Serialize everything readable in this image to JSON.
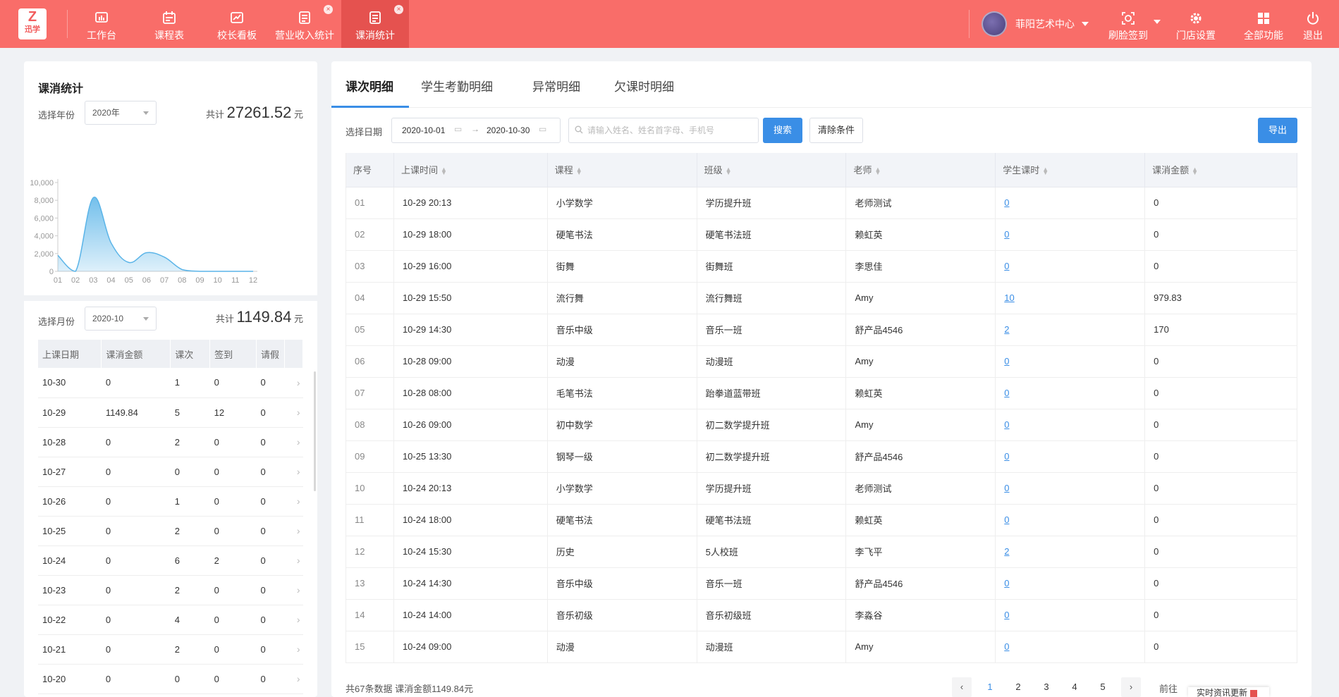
{
  "logo": {
    "mark": "Z",
    "text": "迅学"
  },
  "nav": [
    {
      "label": "工作台",
      "icon": "bar-chart-icon"
    },
    {
      "label": "课程表",
      "icon": "calendar-icon"
    },
    {
      "label": "校长看板",
      "icon": "trend-chart-icon"
    },
    {
      "label": "营业收入统计",
      "icon": "list-icon"
    },
    {
      "label": "课消统计",
      "icon": "list-icon"
    }
  ],
  "user": {
    "name": "菲阳艺术中心"
  },
  "right_nav": [
    {
      "label": "刷脸签到",
      "icon": "face-scan-icon"
    },
    {
      "label": "门店设置",
      "icon": "gear-icon"
    },
    {
      "label": "全部功能",
      "icon": "grid-icon"
    },
    {
      "label": "退出",
      "icon": "power-icon"
    }
  ],
  "left": {
    "title": "课消统计",
    "year_label": "选择年份",
    "year_value": "2020年",
    "year_total_prefix": "共计",
    "year_total": "27261.52",
    "year_total_unit": "元",
    "month_label": "选择月份",
    "month_value": "2020-10",
    "month_total_prefix": "共计",
    "month_total": "1149.84",
    "month_total_unit": "元",
    "table_headers": [
      "上课日期",
      "课消金额",
      "课次",
      "签到",
      "请假"
    ],
    "rows": [
      [
        "10-30",
        "0",
        "1",
        "0",
        "0"
      ],
      [
        "10-29",
        "1149.84",
        "5",
        "12",
        "0"
      ],
      [
        "10-28",
        "0",
        "2",
        "0",
        "0"
      ],
      [
        "10-27",
        "0",
        "0",
        "0",
        "0"
      ],
      [
        "10-26",
        "0",
        "1",
        "0",
        "0"
      ],
      [
        "10-25",
        "0",
        "2",
        "0",
        "0"
      ],
      [
        "10-24",
        "0",
        "6",
        "2",
        "0"
      ],
      [
        "10-23",
        "0",
        "2",
        "0",
        "0"
      ],
      [
        "10-22",
        "0",
        "4",
        "0",
        "0"
      ],
      [
        "10-21",
        "0",
        "2",
        "0",
        "0"
      ],
      [
        "10-20",
        "0",
        "0",
        "0",
        "0"
      ]
    ]
  },
  "chart_data": {
    "type": "area",
    "x": [
      "01",
      "02",
      "03",
      "04",
      "05",
      "06",
      "07",
      "08",
      "09",
      "10",
      "11",
      "12"
    ],
    "y_ticks": [
      "0",
      "2,000",
      "4,000",
      "6,000",
      "8,000",
      "10,000"
    ],
    "ylim": [
      0,
      10000
    ],
    "series": [
      {
        "values": [
          1800,
          0,
          8300,
          3200,
          1000,
          2100,
          1600,
          200,
          0,
          0,
          0,
          0
        ]
      }
    ],
    "color": "#5ab4e8"
  },
  "right": {
    "tabs": [
      "课次明细",
      "学生考勤明细",
      "异常明细",
      "欠课时明细"
    ],
    "filter_label": "选择日期",
    "date_start": "2020-10-01",
    "date_end": "2020-10-30",
    "search_placeholder": "请输入姓名、姓名首字母、手机号",
    "search_btn": "搜索",
    "clear_btn": "清除条件",
    "export_btn": "导出",
    "columns": [
      "序号",
      "上课时间",
      "课程",
      "班级",
      "老师",
      "学生课时",
      "课消金额"
    ],
    "rows": [
      [
        "01",
        "10-29 20:13",
        "小学数学",
        "学历提升班",
        "老师测试",
        "0",
        "0"
      ],
      [
        "02",
        "10-29 18:00",
        "硬笔书法",
        "硬笔书法班",
        "赖虹英",
        "0",
        "0"
      ],
      [
        "03",
        "10-29 16:00",
        "街舞",
        "街舞班",
        "李思佳",
        "0",
        "0"
      ],
      [
        "04",
        "10-29 15:50",
        "流行舞",
        "流行舞班",
        "Amy",
        "10",
        "979.83"
      ],
      [
        "05",
        "10-29 14:30",
        "音乐中级",
        "音乐一班",
        "舒产品4546",
        "2",
        "170"
      ],
      [
        "06",
        "10-28 09:00",
        "动漫",
        "动漫班",
        "Amy",
        "0",
        "0"
      ],
      [
        "07",
        "10-28 08:00",
        "毛笔书法",
        "跆拳道蓝带班",
        "赖虹英",
        "0",
        "0"
      ],
      [
        "08",
        "10-26 09:00",
        "初中数学",
        "初二数学提升班",
        "Amy",
        "0",
        "0"
      ],
      [
        "09",
        "10-25 13:30",
        "钢琴一级",
        "初二数学提升班",
        "舒产品4546",
        "0",
        "0"
      ],
      [
        "10",
        "10-24 20:13",
        "小学数学",
        "学历提升班",
        "老师测试",
        "0",
        "0"
      ],
      [
        "11",
        "10-24 18:00",
        "硬笔书法",
        "硬笔书法班",
        "赖虹英",
        "0",
        "0"
      ],
      [
        "12",
        "10-24 15:30",
        "历史",
        "5人校班",
        "李飞平",
        "2",
        "0"
      ],
      [
        "13",
        "10-24 14:30",
        "音乐中级",
        "音乐一班",
        "舒产品4546",
        "0",
        "0"
      ],
      [
        "14",
        "10-24 14:00",
        "音乐初级",
        "音乐初级班",
        "李淼谷",
        "0",
        "0"
      ],
      [
        "15",
        "10-24 09:00",
        "动漫",
        "动漫班",
        "Amy",
        "0",
        "0"
      ]
    ],
    "footer": "共67条数据 课消金额1149.84元",
    "pages": [
      "1",
      "2",
      "3",
      "4",
      "5"
    ],
    "goto_label": "前往"
  },
  "toast": "实时资讯更新"
}
